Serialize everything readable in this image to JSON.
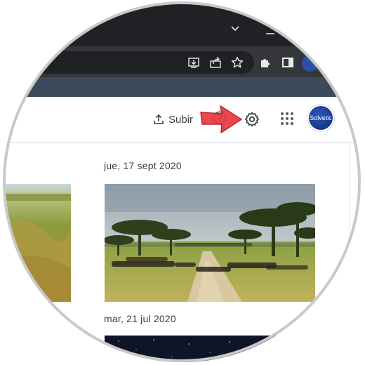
{
  "header": {
    "upload_label": "Subir",
    "avatar_text": "Solvetic"
  },
  "toolbar_icons": [
    "install-icon",
    "share-icon",
    "star-icon",
    "extensions-icon",
    "side-panel-icon",
    "profile-icon"
  ],
  "header_icons": [
    "upload-icon",
    "help-icon",
    "settings-icon",
    "apps-grid-icon",
    "account-avatar"
  ],
  "sections": [
    {
      "date": "jue, 17 sept 2020"
    },
    {
      "date": "mar, 21 jul 2020"
    }
  ],
  "colors": {
    "titlebar": "#202124",
    "toolbar": "#35363a",
    "bookmarks_bar": "#3c4a5c",
    "annotation_arrow": "#e8373f",
    "avatar": "#1a3a9c"
  }
}
